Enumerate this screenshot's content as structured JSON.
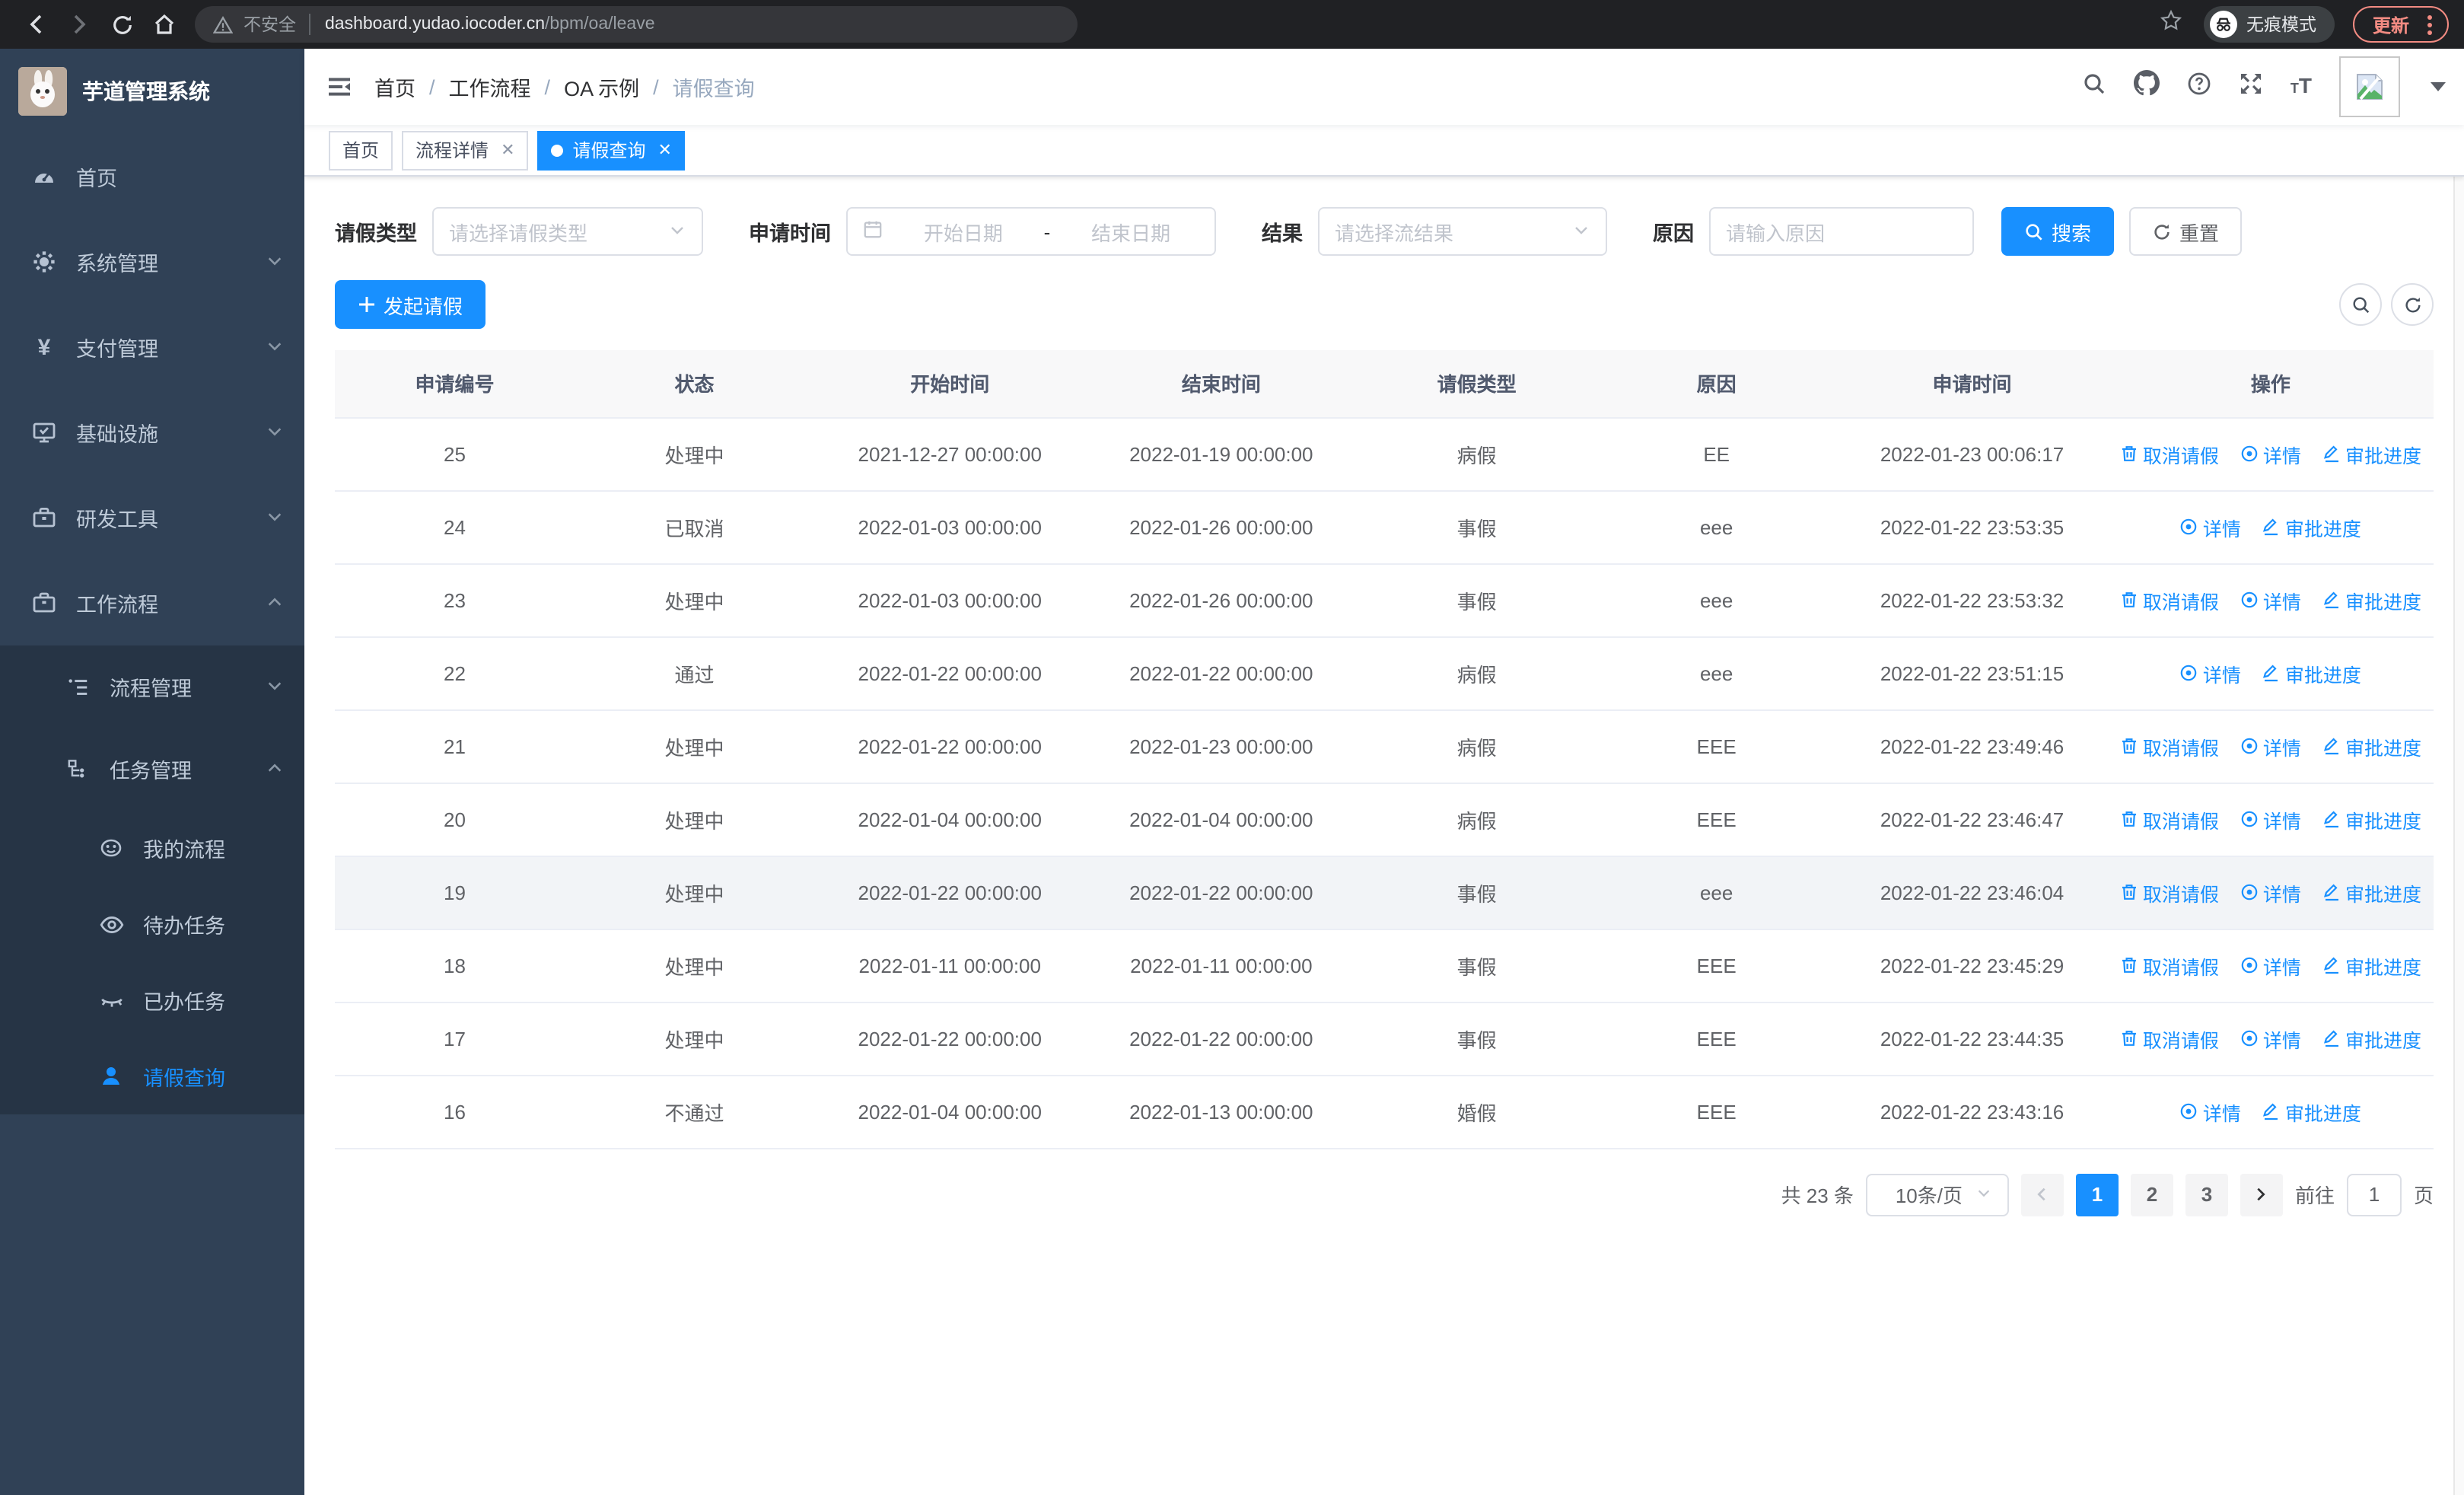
{
  "browser": {
    "security_label": "不安全",
    "url_host": "dashboard.yudao.iocoder.cn",
    "url_path": "/bpm/oa/leave",
    "incognito_label": "无痕模式",
    "update_label": "更新"
  },
  "sidebar": {
    "title": "芋道管理系统",
    "items": [
      {
        "label": "首页"
      },
      {
        "label": "系统管理"
      },
      {
        "label": "支付管理"
      },
      {
        "label": "基础设施"
      },
      {
        "label": "研发工具"
      },
      {
        "label": "工作流程"
      }
    ],
    "submenu": [
      {
        "label": "流程管理"
      },
      {
        "label": "任务管理"
      }
    ],
    "task_children": [
      {
        "label": "我的流程"
      },
      {
        "label": "待办任务"
      },
      {
        "label": "已办任务"
      },
      {
        "label": "请假查询"
      }
    ]
  },
  "navbar": {
    "breadcrumb": [
      "首页",
      "工作流程",
      "OA 示例",
      "请假查询"
    ]
  },
  "tabs": [
    {
      "label": "首页"
    },
    {
      "label": "流程详情"
    },
    {
      "label": "请假查询"
    }
  ],
  "filters": {
    "leave_type_label": "请假类型",
    "leave_type_placeholder": "请选择请假类型",
    "apply_time_label": "申请时间",
    "start_date_placeholder": "开始日期",
    "range_separator": "-",
    "end_date_placeholder": "结束日期",
    "result_label": "结果",
    "result_placeholder": "请选择流结果",
    "reason_label": "原因",
    "reason_placeholder": "请输入原因",
    "search_label": "搜索",
    "reset_label": "重置"
  },
  "toolbar": {
    "create_label": "发起请假"
  },
  "table": {
    "columns": [
      "申请编号",
      "状态",
      "开始时间",
      "结束时间",
      "请假类型",
      "原因",
      "申请时间",
      "操作"
    ],
    "actions": {
      "cancel": "取消请假",
      "detail": "详情",
      "progress": "审批进度"
    },
    "rows": [
      {
        "id": "25",
        "status": "处理中",
        "start": "2021-12-27 00:00:00",
        "end": "2022-01-19 00:00:00",
        "type": "病假",
        "reason": "EE",
        "applied": "2022-01-23 00:06:17",
        "cancellable": true,
        "highlighted": false
      },
      {
        "id": "24",
        "status": "已取消",
        "start": "2022-01-03 00:00:00",
        "end": "2022-01-26 00:00:00",
        "type": "事假",
        "reason": "eee",
        "applied": "2022-01-22 23:53:35",
        "cancellable": false,
        "highlighted": false
      },
      {
        "id": "23",
        "status": "处理中",
        "start": "2022-01-03 00:00:00",
        "end": "2022-01-26 00:00:00",
        "type": "事假",
        "reason": "eee",
        "applied": "2022-01-22 23:53:32",
        "cancellable": true,
        "highlighted": false
      },
      {
        "id": "22",
        "status": "通过",
        "start": "2022-01-22 00:00:00",
        "end": "2022-01-22 00:00:00",
        "type": "病假",
        "reason": "eee",
        "applied": "2022-01-22 23:51:15",
        "cancellable": false,
        "highlighted": false
      },
      {
        "id": "21",
        "status": "处理中",
        "start": "2022-01-22 00:00:00",
        "end": "2022-01-23 00:00:00",
        "type": "病假",
        "reason": "EEE",
        "applied": "2022-01-22 23:49:46",
        "cancellable": true,
        "highlighted": false
      },
      {
        "id": "20",
        "status": "处理中",
        "start": "2022-01-04 00:00:00",
        "end": "2022-01-04 00:00:00",
        "type": "病假",
        "reason": "EEE",
        "applied": "2022-01-22 23:46:47",
        "cancellable": true,
        "highlighted": false
      },
      {
        "id": "19",
        "status": "处理中",
        "start": "2022-01-22 00:00:00",
        "end": "2022-01-22 00:00:00",
        "type": "事假",
        "reason": "eee",
        "applied": "2022-01-22 23:46:04",
        "cancellable": true,
        "highlighted": true
      },
      {
        "id": "18",
        "status": "处理中",
        "start": "2022-01-11 00:00:00",
        "end": "2022-01-11 00:00:00",
        "type": "事假",
        "reason": "EEE",
        "applied": "2022-01-22 23:45:29",
        "cancellable": true,
        "highlighted": false
      },
      {
        "id": "17",
        "status": "处理中",
        "start": "2022-01-22 00:00:00",
        "end": "2022-01-22 00:00:00",
        "type": "事假",
        "reason": "EEE",
        "applied": "2022-01-22 23:44:35",
        "cancellable": true,
        "highlighted": false
      },
      {
        "id": "16",
        "status": "不通过",
        "start": "2022-01-04 00:00:00",
        "end": "2022-01-13 00:00:00",
        "type": "婚假",
        "reason": "EEE",
        "applied": "2022-01-22 23:43:16",
        "cancellable": false,
        "highlighted": false
      }
    ]
  },
  "pagination": {
    "total": "共 23 条",
    "page_size": "10条/页",
    "pages": [
      "1",
      "2",
      "3"
    ],
    "active_page": "1",
    "goto_label": "前往",
    "goto_value": "1",
    "goto_suffix": "页"
  },
  "colors": {
    "accent": "#1890ff",
    "sidebar_bg": "#304156",
    "submenu_bg": "#263445",
    "browser_bg": "#202124",
    "update_color": "#f28b82"
  }
}
